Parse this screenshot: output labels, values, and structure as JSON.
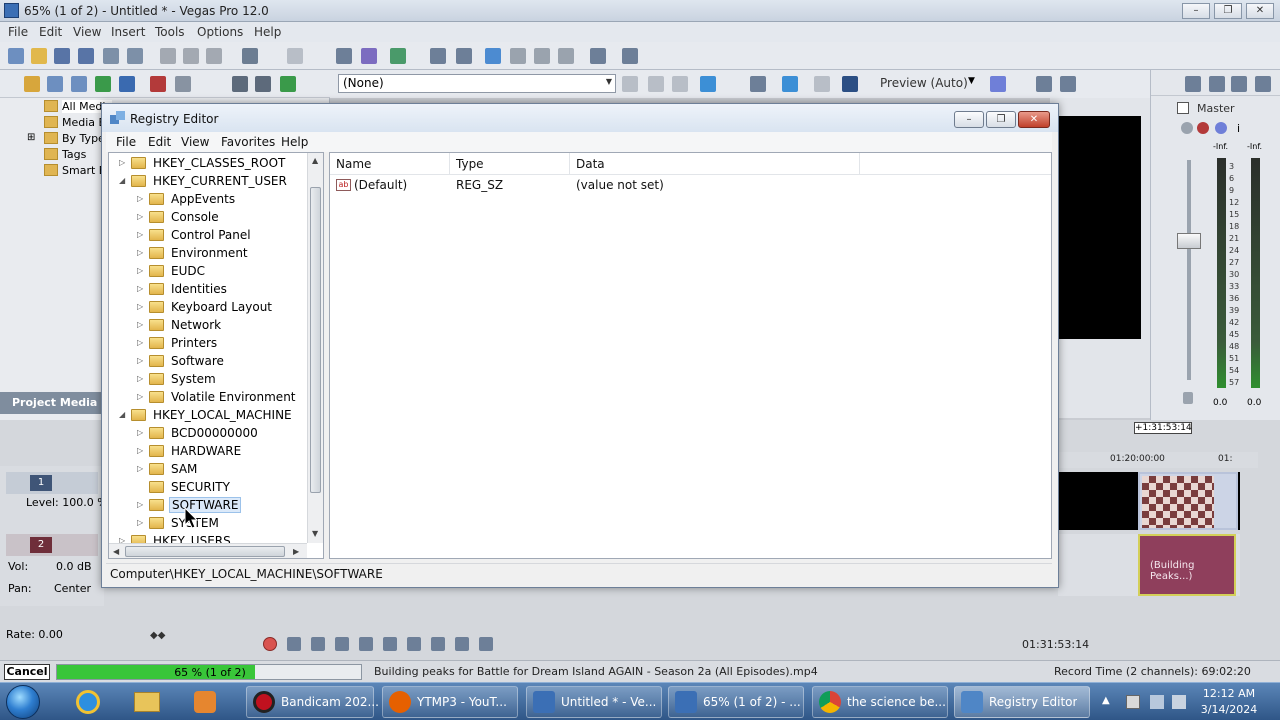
{
  "vegas": {
    "window_title": "65% (1 of 2) - Untitled * - Vegas Pro 12.0",
    "menu": [
      "File",
      "Edit",
      "View",
      "Insert",
      "Tools",
      "Options",
      "Help"
    ],
    "preview_select": "(None)",
    "preview_mode": "Preview (Auto)",
    "master_label": "Master",
    "meter_top": "-Inf.",
    "meter_scale": [
      "3",
      "6",
      "9",
      "12",
      "15",
      "18",
      "21",
      "24",
      "27",
      "30",
      "33",
      "36",
      "39",
      "42",
      "45",
      "48",
      "51",
      "54",
      "57"
    ],
    "meter_bottom_left": "0.0",
    "meter_bottom_right": "0.0",
    "media_tree": [
      "All Media",
      "Media B",
      "By Type",
      "Tags",
      "Smart B"
    ],
    "project_media_tab": "Project Media",
    "timecode_flag": "+1:31:53:14",
    "ruler_labels": [
      "01:20:00:00",
      "01:"
    ],
    "track1_num": "1",
    "track2_num": "2",
    "level_label": "Level: 100.0 %",
    "vol_label": "Vol:",
    "vol_value": "0.0 dB",
    "pan_label": "Pan:",
    "pan_value": "Center",
    "rate_label": "Rate: 0.00",
    "audio_clip_label": "(Building Peaks...)",
    "transport_time": "01:31:53:14"
  },
  "status": {
    "cancel_label": "Cancel",
    "progress_text": "65 % (1 of 2)",
    "progress_value": 0.65,
    "file_text": "Building peaks for Battle for Dream Island AGAIN - Season 2a (All Episodes).mp4",
    "record_text": "Record Time (2 channels): 69:02:20"
  },
  "regedit": {
    "title": "Registry Editor",
    "menu": [
      "File",
      "Edit",
      "View",
      "Favorites",
      "Help"
    ],
    "tree": [
      {
        "label": "HKEY_CLASSES_ROOT",
        "level": 0,
        "expander": "▷"
      },
      {
        "label": "HKEY_CURRENT_USER",
        "level": 0,
        "expander": "◢"
      },
      {
        "label": "AppEvents",
        "level": 1,
        "expander": "▷"
      },
      {
        "label": "Console",
        "level": 1,
        "expander": "▷"
      },
      {
        "label": "Control Panel",
        "level": 1,
        "expander": "▷"
      },
      {
        "label": "Environment",
        "level": 1,
        "expander": "▷"
      },
      {
        "label": "EUDC",
        "level": 1,
        "expander": "▷"
      },
      {
        "label": "Identities",
        "level": 1,
        "expander": "▷"
      },
      {
        "label": "Keyboard Layout",
        "level": 1,
        "expander": "▷"
      },
      {
        "label": "Network",
        "level": 1,
        "expander": "▷"
      },
      {
        "label": "Printers",
        "level": 1,
        "expander": "▷"
      },
      {
        "label": "Software",
        "level": 1,
        "expander": "▷"
      },
      {
        "label": "System",
        "level": 1,
        "expander": "▷"
      },
      {
        "label": "Volatile Environment",
        "level": 1,
        "expander": "▷"
      },
      {
        "label": "HKEY_LOCAL_MACHINE",
        "level": 0,
        "expander": "◢"
      },
      {
        "label": "BCD00000000",
        "level": 1,
        "expander": "▷"
      },
      {
        "label": "HARDWARE",
        "level": 1,
        "expander": "▷"
      },
      {
        "label": "SAM",
        "level": 1,
        "expander": "▷"
      },
      {
        "label": "SECURITY",
        "level": 1,
        "expander": ""
      },
      {
        "label": "SOFTWARE",
        "level": 1,
        "expander": "▷",
        "selected": true
      },
      {
        "label": "SYSTEM",
        "level": 1,
        "expander": "▷"
      },
      {
        "label": "HKEY_USERS",
        "level": 0,
        "expander": "▷"
      }
    ],
    "columns": {
      "name": "Name",
      "type": "Type",
      "data": "Data"
    },
    "rows": [
      {
        "name": "(Default)",
        "type": "REG_SZ",
        "data": "(value not set)"
      }
    ],
    "status_path": "Computer\\HKEY_LOCAL_MACHINE\\SOFTWARE"
  },
  "taskbar": {
    "tasks": [
      {
        "label": "Bandicam 202...",
        "color": "#c0111f"
      },
      {
        "label": "YTMP3 - YouT...",
        "color": "#e66000"
      },
      {
        "label": "Untitled * - Ve...",
        "color": "#3b6fb5"
      },
      {
        "label": "65% (1 of 2) - ...",
        "color": "#3b6fb5"
      },
      {
        "label": "the science be...",
        "color": "#2a9d4a"
      },
      {
        "label": "Registry Editor",
        "color": "#4f86c6"
      }
    ],
    "time": "12:12 AM",
    "date": "3/14/2024"
  }
}
